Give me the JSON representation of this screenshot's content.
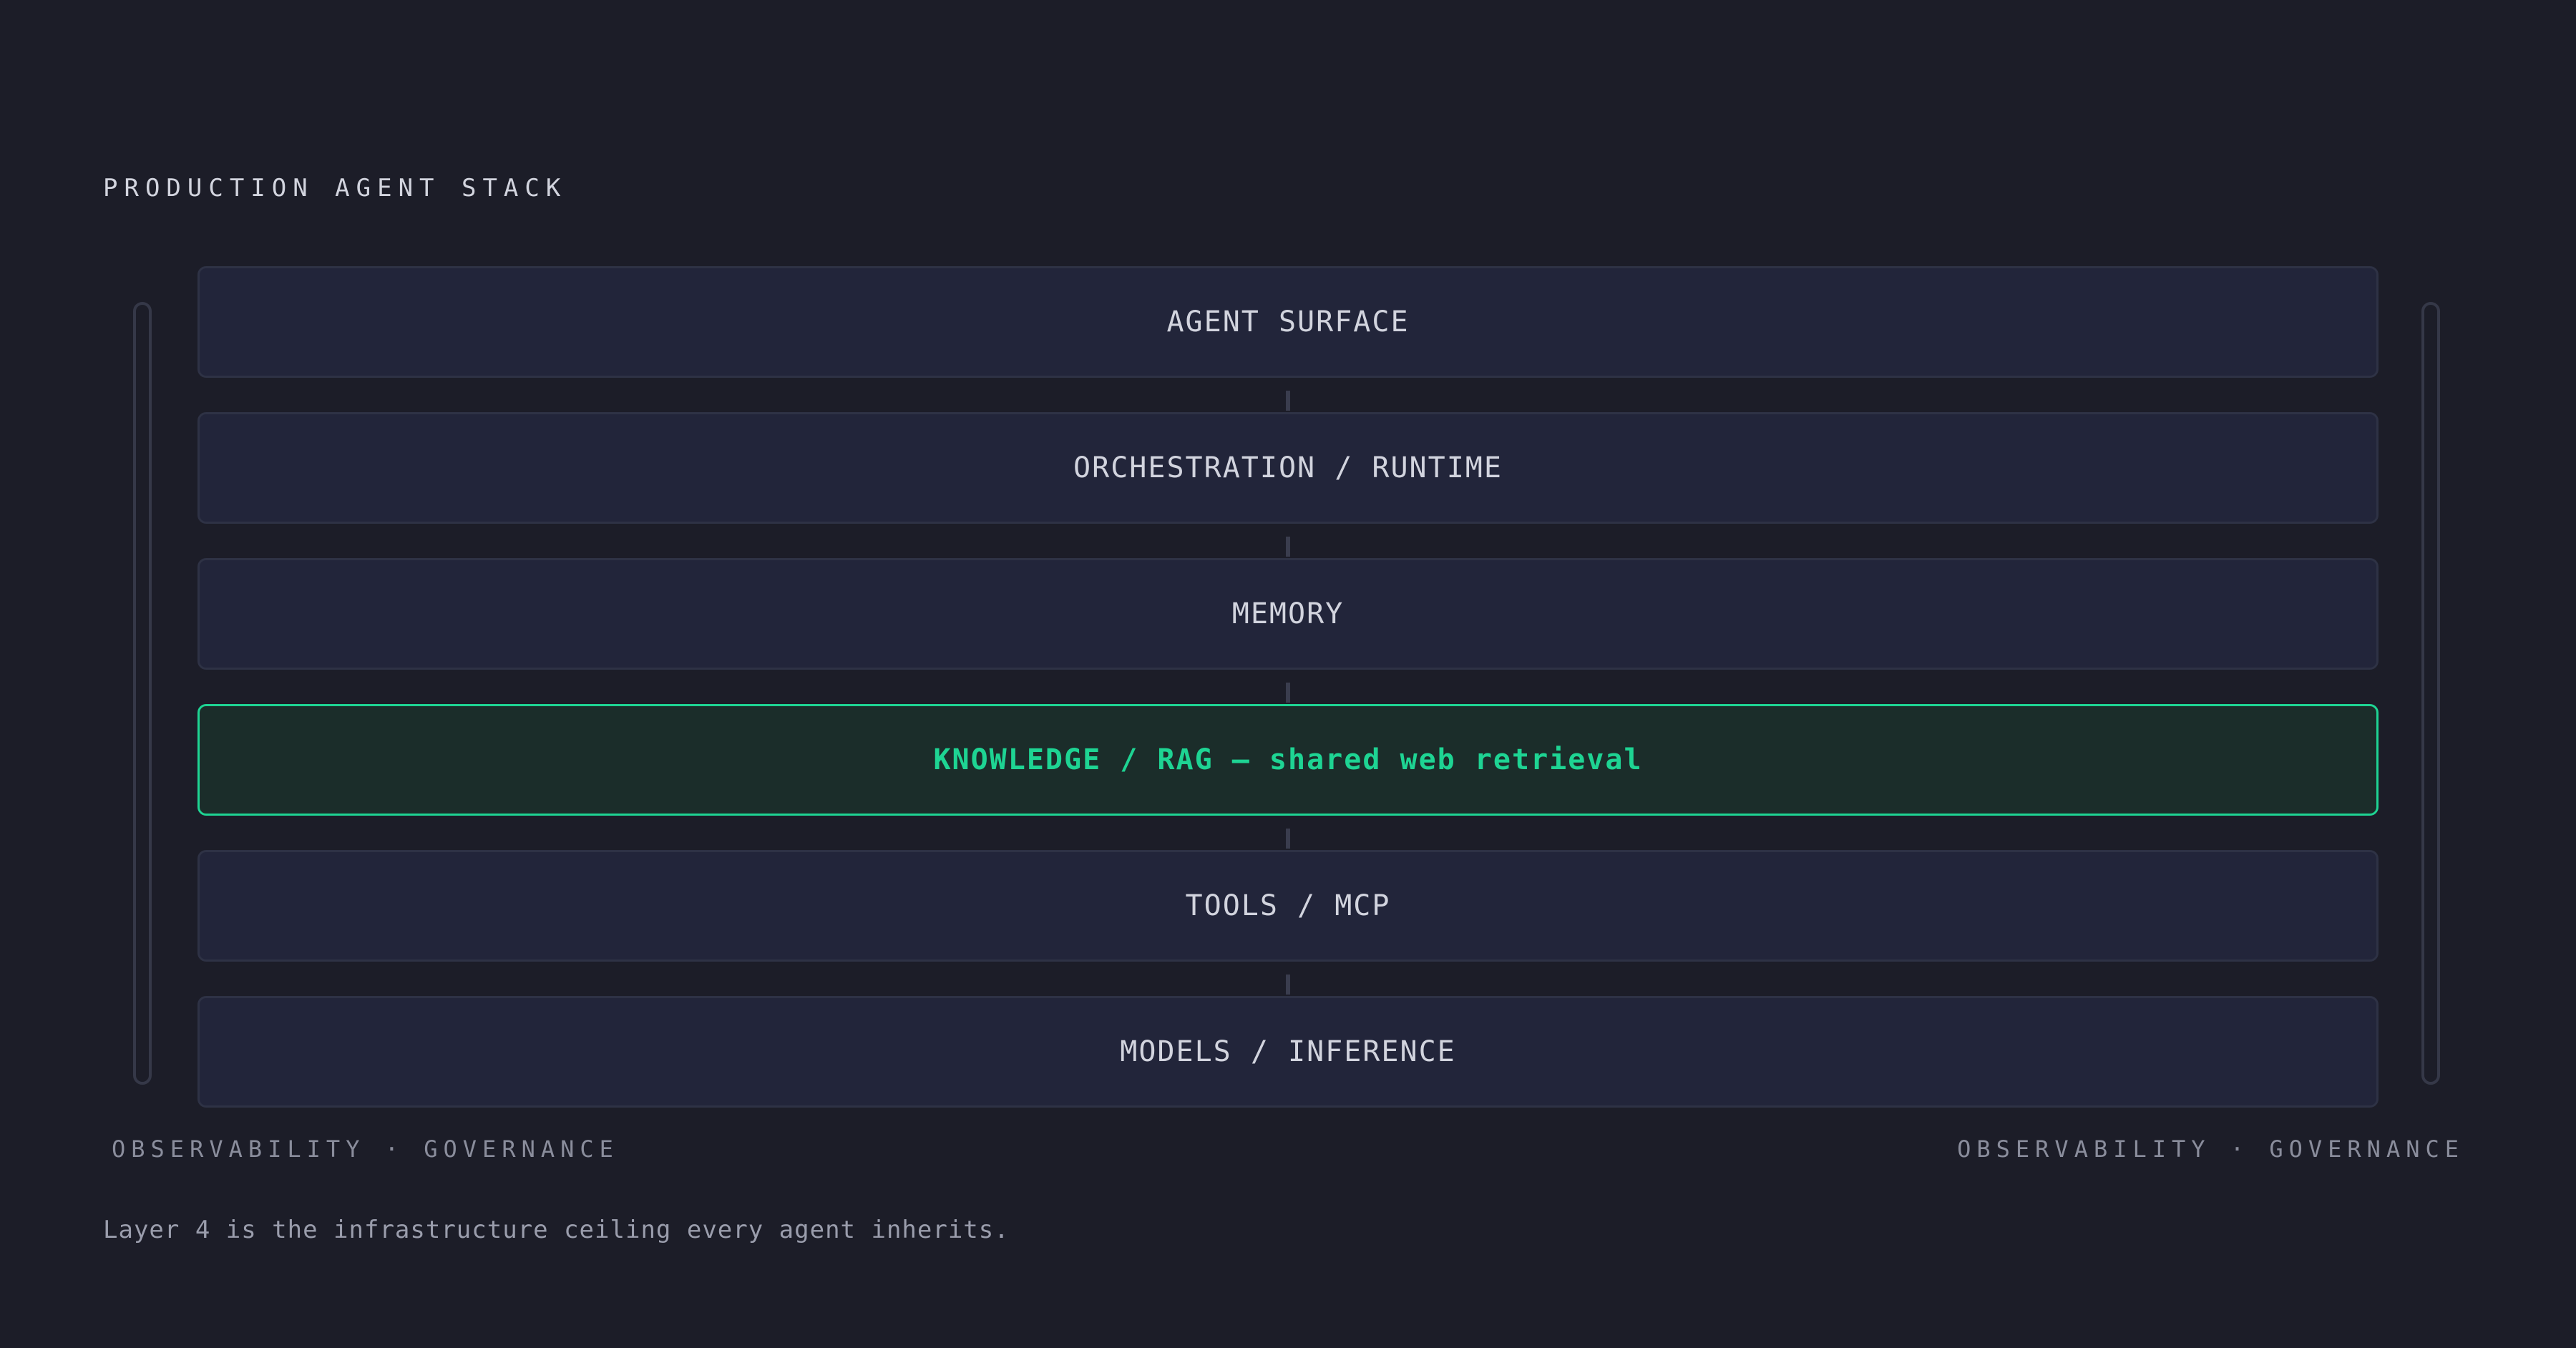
{
  "title": "PRODUCTION AGENT STACK",
  "layers": [
    {
      "label": "AGENT SURFACE",
      "highlighted": false
    },
    {
      "label": "ORCHESTRATION / RUNTIME",
      "highlighted": false
    },
    {
      "label": "MEMORY",
      "highlighted": false
    },
    {
      "label": "KNOWLEDGE / RAG — shared web retrieval",
      "highlighted": true
    },
    {
      "label": "TOOLS / MCP",
      "highlighted": false
    },
    {
      "label": "MODELS / INFERENCE",
      "highlighted": false
    }
  ],
  "rails": {
    "left_label": "OBSERVABILITY · GOVERNANCE",
    "right_label": "OBSERVABILITY · GOVERNANCE"
  },
  "caption": "Layer 4 is the infrastructure ceiling every agent inherits.",
  "colors": {
    "background": "#1c1d28",
    "layer_fill": "#22253a",
    "highlight_accent": "#1ed493",
    "highlight_fill": "#1b2d2a"
  }
}
